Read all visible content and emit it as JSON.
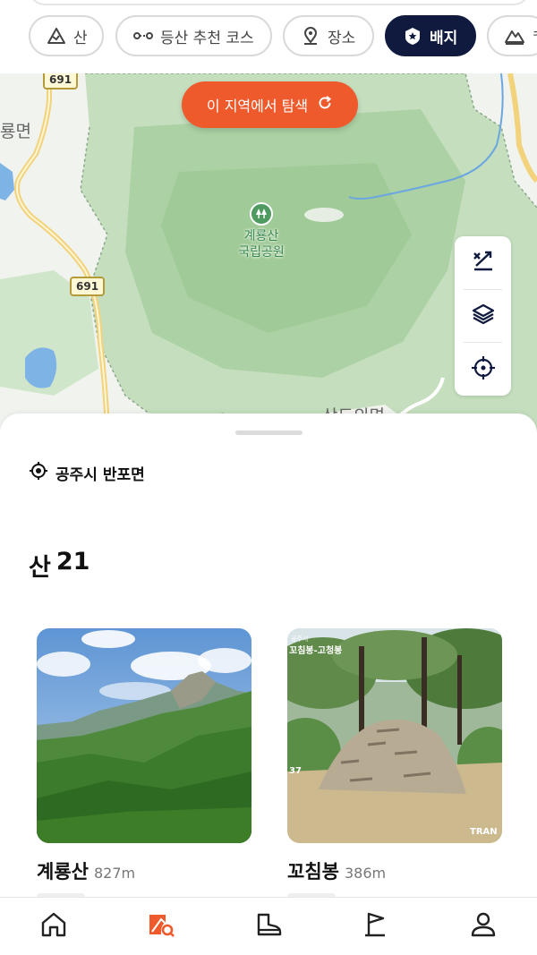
{
  "filters": [
    {
      "label": "산",
      "icon": "mountain-outline-icon",
      "active": false
    },
    {
      "label": "등산 추천 코스",
      "icon": "route-icon",
      "active": false
    },
    {
      "label": "장소",
      "icon": "location-pin-icon",
      "active": false
    },
    {
      "label": "배지",
      "icon": "badge-star-icon",
      "active": true
    },
    {
      "label": "ᄏ",
      "icon": "mountain-peaks-icon",
      "active": false
    }
  ],
  "map": {
    "explore_button": "이 지역에서 탐색",
    "road_numbers": [
      "691",
      "691"
    ],
    "labels": {
      "west_town": "룡면",
      "south_town": "상도의면"
    },
    "poi": {
      "name_line1": "계룡산",
      "name_line2": "국립공원",
      "icon": "tree-icon"
    },
    "controls": [
      "hiking-trace-icon",
      "layers-icon",
      "current-location-icon"
    ]
  },
  "sheet": {
    "location": "공주시 반포면",
    "section_title": "산",
    "section_count": "21",
    "cards": [
      {
        "name": "계룡산",
        "elevation": "827m",
        "photo": "mountain-landscape"
      },
      {
        "name": "꼬침봉",
        "elevation": "386m",
        "photo": "stone-cairn",
        "photo_caption_small": "공주시",
        "photo_caption": "꼬침봉-고청봉",
        "photo_side_number": "37",
        "photo_watermark": "TRAN"
      }
    ]
  },
  "tabbar": [
    "home-icon",
    "map-search-icon",
    "boot-icon",
    "flag-icon",
    "profile-icon"
  ],
  "colors": {
    "accent": "#ef5a2c",
    "navy": "#101a3e",
    "forest": "#a9cfa3"
  }
}
